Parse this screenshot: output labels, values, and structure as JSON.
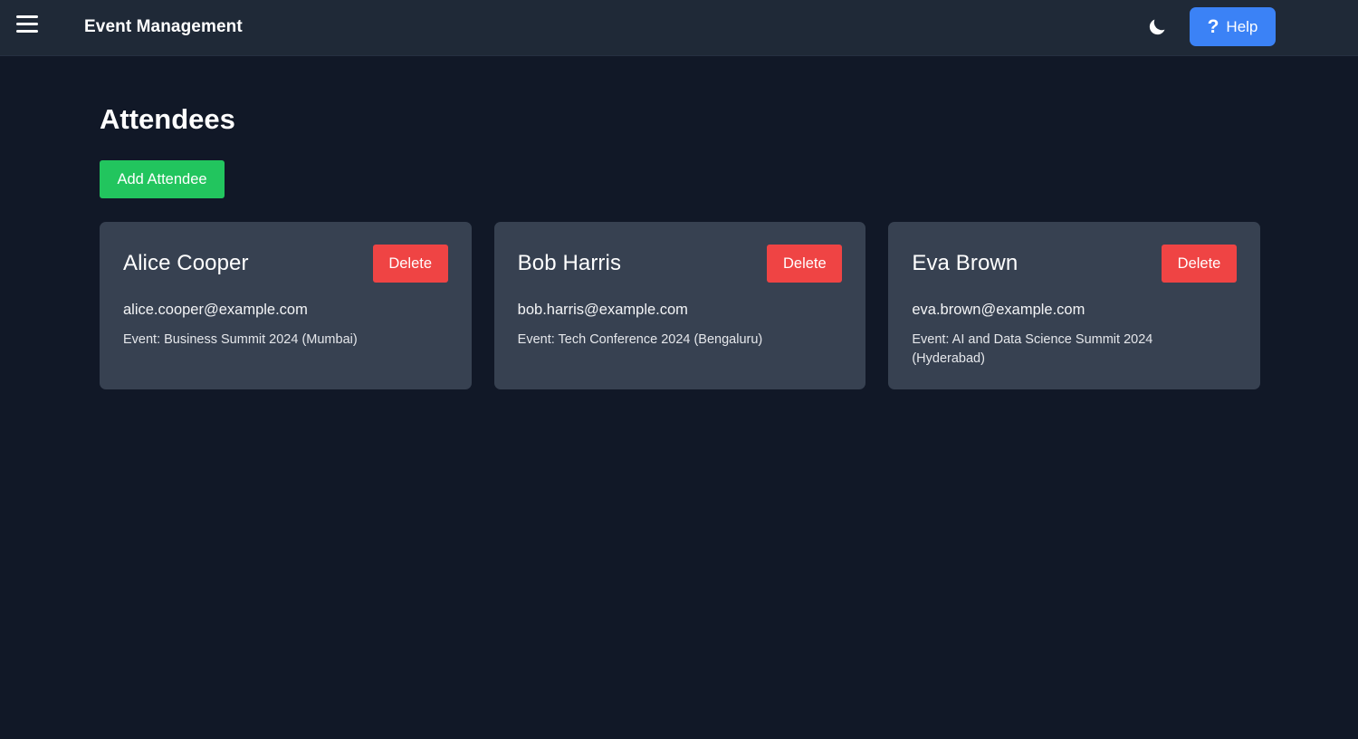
{
  "header": {
    "title": "Event Management",
    "menu_icon": "hamburger-menu-icon",
    "theme_icon": "moon-icon",
    "help_label": "Help",
    "help_icon_glyph": "?",
    "colors": {
      "bar": "#1f2937",
      "help": "#3b82f6"
    }
  },
  "main": {
    "title": "Attendees",
    "add_label": "Add Attendee",
    "colors": {
      "background": "#111827",
      "card": "#374151",
      "add": "#22c55e",
      "delete": "#ef4444"
    }
  },
  "attendees": [
    {
      "name": "Alice Cooper",
      "email": "alice.cooper@example.com",
      "event": "Event: Business Summit 2024 (Mumbai)",
      "delete_label": "Delete"
    },
    {
      "name": "Bob Harris",
      "email": "bob.harris@example.com",
      "event": "Event: Tech Conference 2024 (Bengaluru)",
      "delete_label": "Delete"
    },
    {
      "name": "Eva Brown",
      "email": "eva.brown@example.com",
      "event": "Event: AI and Data Science Summit 2024 (Hyderabad)",
      "delete_label": "Delete"
    }
  ]
}
